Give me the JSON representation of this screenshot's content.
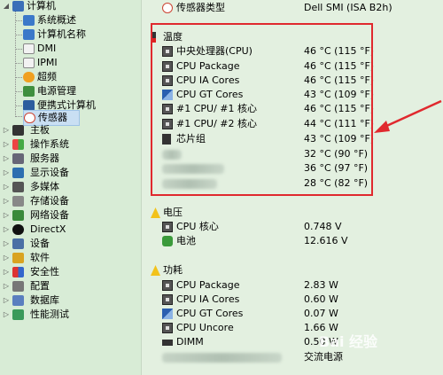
{
  "tree": {
    "computer": {
      "label": "计算机",
      "children": [
        "系统概述",
        "计算机名称",
        "DMI",
        "IPMI",
        "超频",
        "电源管理",
        "便携式计算机",
        "传感器"
      ]
    },
    "categories": [
      "主板",
      "操作系统",
      "服务器",
      "显示设备",
      "多媒体",
      "存储设备",
      "网络设备",
      "DirectX",
      "设备",
      "软件",
      "安全性",
      "配置",
      "数据库",
      "性能测试"
    ]
  },
  "panel": {
    "sensor_type": {
      "label": "传感器类型",
      "value": "Dell SMI  (ISA B2h)"
    },
    "temperature": {
      "header": "温度",
      "rows": [
        {
          "label": "中央处理器(CPU)",
          "value": "46 °C  (115 °F)"
        },
        {
          "label": "CPU Package",
          "value": "46 °C  (115 °F)"
        },
        {
          "label": "CPU IA Cores",
          "value": "46 °C  (115 °F)"
        },
        {
          "label": "CPU GT Cores",
          "value": "43 °C  (109 °F)"
        },
        {
          "label": "#1 CPU/ #1 核心",
          "value": "46 °C  (115 °F)"
        },
        {
          "label": "#1 CPU/ #2 核心",
          "value": "44 °C  (111 °F)"
        },
        {
          "label": "芯片组",
          "value": "43 °C  (109 °F)"
        },
        {
          "label": "",
          "value": "32 °C  (90 °F)"
        },
        {
          "label": "",
          "value": "36 °C  (97 °F)"
        },
        {
          "label": "",
          "value": "28 °C  (82 °F)"
        }
      ]
    },
    "voltage": {
      "header": "电压",
      "rows": [
        {
          "label": "CPU 核心",
          "value": "0.748 V"
        },
        {
          "label": "电池",
          "value": "12.616 V"
        }
      ]
    },
    "power": {
      "header": "功耗",
      "rows": [
        {
          "label": "CPU Package",
          "value": "2.83 W"
        },
        {
          "label": "CPU IA Cores",
          "value": "0.60 W"
        },
        {
          "label": "CPU GT Cores",
          "value": "0.07 W"
        },
        {
          "label": "CPU Uncore",
          "value": "1.66 W"
        },
        {
          "label": "DIMM",
          "value": "0.50 W"
        },
        {
          "label": "",
          "value": "交流电源"
        }
      ]
    }
  },
  "watermark": {
    "text": "Bai 经验"
  },
  "colors": {
    "highlight_box": "#e0292e",
    "arrow": "#e0292e",
    "tree_bg": "#d8ecd6",
    "panel_bg": "#e3f0e0"
  }
}
